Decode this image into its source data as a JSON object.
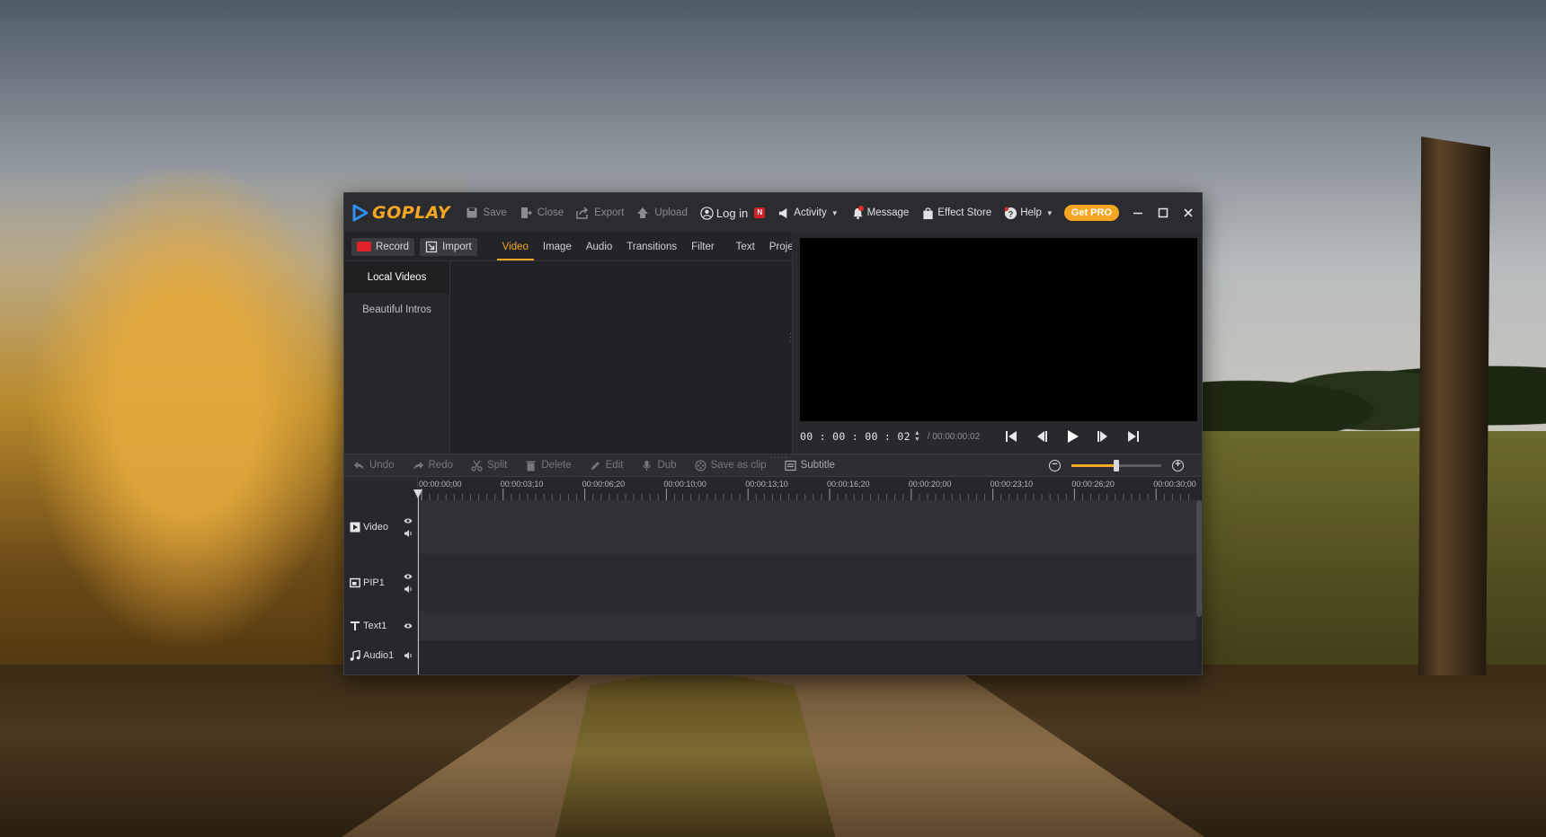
{
  "app": {
    "name": "GOPLAY",
    "toolbar": {
      "save": "Save",
      "close": "Close",
      "export": "Export",
      "upload": "Upload"
    },
    "account": {
      "login": "Log in",
      "new_badge": "N"
    },
    "menu": {
      "activity": "Activity",
      "message": "Message",
      "effect_store": "Effect Store",
      "help": "Help",
      "get_pro": "Get PRO"
    },
    "colors": {
      "accent": "#f5a623",
      "record": "#e0232a",
      "badge": "#d0202a"
    }
  },
  "media": {
    "record": "Record",
    "import": "Import",
    "tabs": [
      "Video",
      "Image",
      "Audio",
      "Transitions",
      "Filter",
      "Text",
      "Project"
    ],
    "active_tab": "Video",
    "categories": [
      "Local Videos",
      "Beautiful Intros"
    ],
    "active_category": "Local Videos"
  },
  "player": {
    "timecode": "00 : 00 : 00 : 02",
    "duration": "/ 00:00:00:02"
  },
  "edit": {
    "undo": "Undo",
    "redo": "Redo",
    "split": "Split",
    "delete": "Delete",
    "edit": "Edit",
    "dub": "Dub",
    "save_as_clip": "Save as clip",
    "subtitle": "Subtitle",
    "zoom_level": 0.5
  },
  "timeline": {
    "ruler": [
      "00:00:00;00",
      "00:00:03;10",
      "00:00:06;20",
      "00:00:10;00",
      "00:00:13;10",
      "00:00:16;20",
      "00:00:20;00",
      "00:00:23;10",
      "00:00:26;20",
      "00:00:30;00"
    ],
    "tracks": {
      "video": "Video",
      "pip": "PIP1",
      "text": "Text1",
      "audio": "Audio1"
    }
  }
}
